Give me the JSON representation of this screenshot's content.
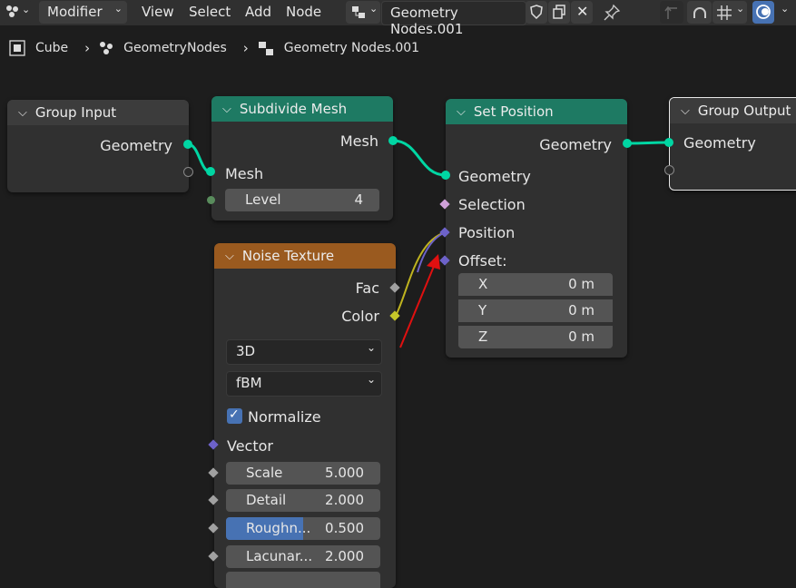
{
  "header": {
    "editor_type_icon": "node-editor-icon",
    "modifier_dropdown": "Modifier",
    "menus": [
      "View",
      "Select",
      "Add",
      "Node"
    ],
    "node_group_name": "Geometry Nodes.001"
  },
  "breadcrumb": {
    "items": [
      "Cube",
      "GeometryNodes",
      "Geometry Nodes.001"
    ]
  },
  "nodes": {
    "group_input": {
      "title": "Group Input",
      "out_geometry": "Geometry"
    },
    "subdivide": {
      "title": "Subdivide Mesh",
      "out_mesh": "Mesh",
      "in_mesh": "Mesh",
      "level_label": "Level",
      "level_value": "4"
    },
    "set_position": {
      "title": "Set Position",
      "out_geometry": "Geometry",
      "in_geometry": "Geometry",
      "selection": "Selection",
      "position": "Position",
      "offset": "Offset:",
      "x_label": "X",
      "x_value": "0 m",
      "y_label": "Y",
      "y_value": "0 m",
      "z_label": "Z",
      "z_value": "0 m"
    },
    "group_output": {
      "title": "Group Output",
      "in_geometry": "Geometry"
    },
    "noise": {
      "title": "Noise Texture",
      "fac": "Fac",
      "color": "Color",
      "dimensions": "3D",
      "type": "fBM",
      "normalize": "Normalize",
      "vector": "Vector",
      "scale_label": "Scale",
      "scale_value": "5.000",
      "detail_label": "Detail",
      "detail_value": "2.000",
      "roughness_label": "Roughn...",
      "roughness_value": "0.500",
      "roughness_fill": 0.5,
      "lacunarity_label": "Lacunar...",
      "lacunarity_value": "2.000"
    }
  },
  "colors": {
    "geometry_socket": "#00d6a3",
    "green_header": "#1e7a63",
    "orange_header": "#9a5a1f",
    "annotation_arrow": "#e01010"
  }
}
